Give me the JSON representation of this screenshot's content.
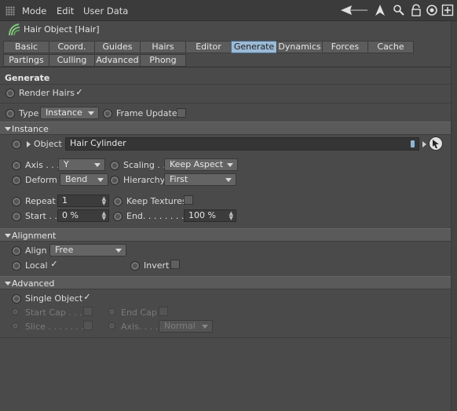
{
  "menu": {
    "items": [
      "Mode",
      "Edit",
      "User Data"
    ]
  },
  "header": {
    "title": "Hair Object [Hair]"
  },
  "tabs": {
    "row1": [
      "Basic",
      "Coord.",
      "Guides",
      "Hairs",
      "Editor",
      "Generate",
      "Dynamics",
      "Forces",
      "Cache"
    ],
    "row2": [
      "Partings",
      "Culling",
      "Advanced",
      "Phong"
    ],
    "active": "Generate"
  },
  "generate": {
    "section_title": "Generate",
    "render_hairs_label": "Render Hairs",
    "render_hairs_checked": "✓",
    "type_label": "Type",
    "type_value": "Instance",
    "frame_update_label": "Frame Update"
  },
  "instance": {
    "section_title": "Instance",
    "object_label": "Object",
    "object_value": "Hair Cylinder",
    "axis_label": "Axis . . .",
    "axis_value": "Y",
    "scaling_label": "Scaling . .",
    "scaling_value": "Keep Aspect",
    "deform_label": "Deform",
    "deform_value": "Bend",
    "hierarchy_label": "Hierarchy",
    "hierarchy_value": "First",
    "repeat_label": "Repeat",
    "repeat_value": "1",
    "keep_textures_label": "Keep Textures",
    "start_label": "Start . .",
    "start_value": "0 %",
    "end_label": "End. . . . . . . . .",
    "end_value": "100 %"
  },
  "alignment": {
    "section_title": "Alignment",
    "align_label": "Align",
    "align_value": "Free",
    "local_label": "Local",
    "local_checked": "✓",
    "invert_label": "Invert"
  },
  "advanced": {
    "section_title": "Advanced",
    "single_object_label": "Single Object",
    "single_object_checked": "✓",
    "start_cap_label": "Start Cap . . .",
    "end_cap_label": "End Cap",
    "slice_label": "Slice . . . . . . . .",
    "axis_label": "Axis. . . . .",
    "axis_value": "Normal"
  }
}
